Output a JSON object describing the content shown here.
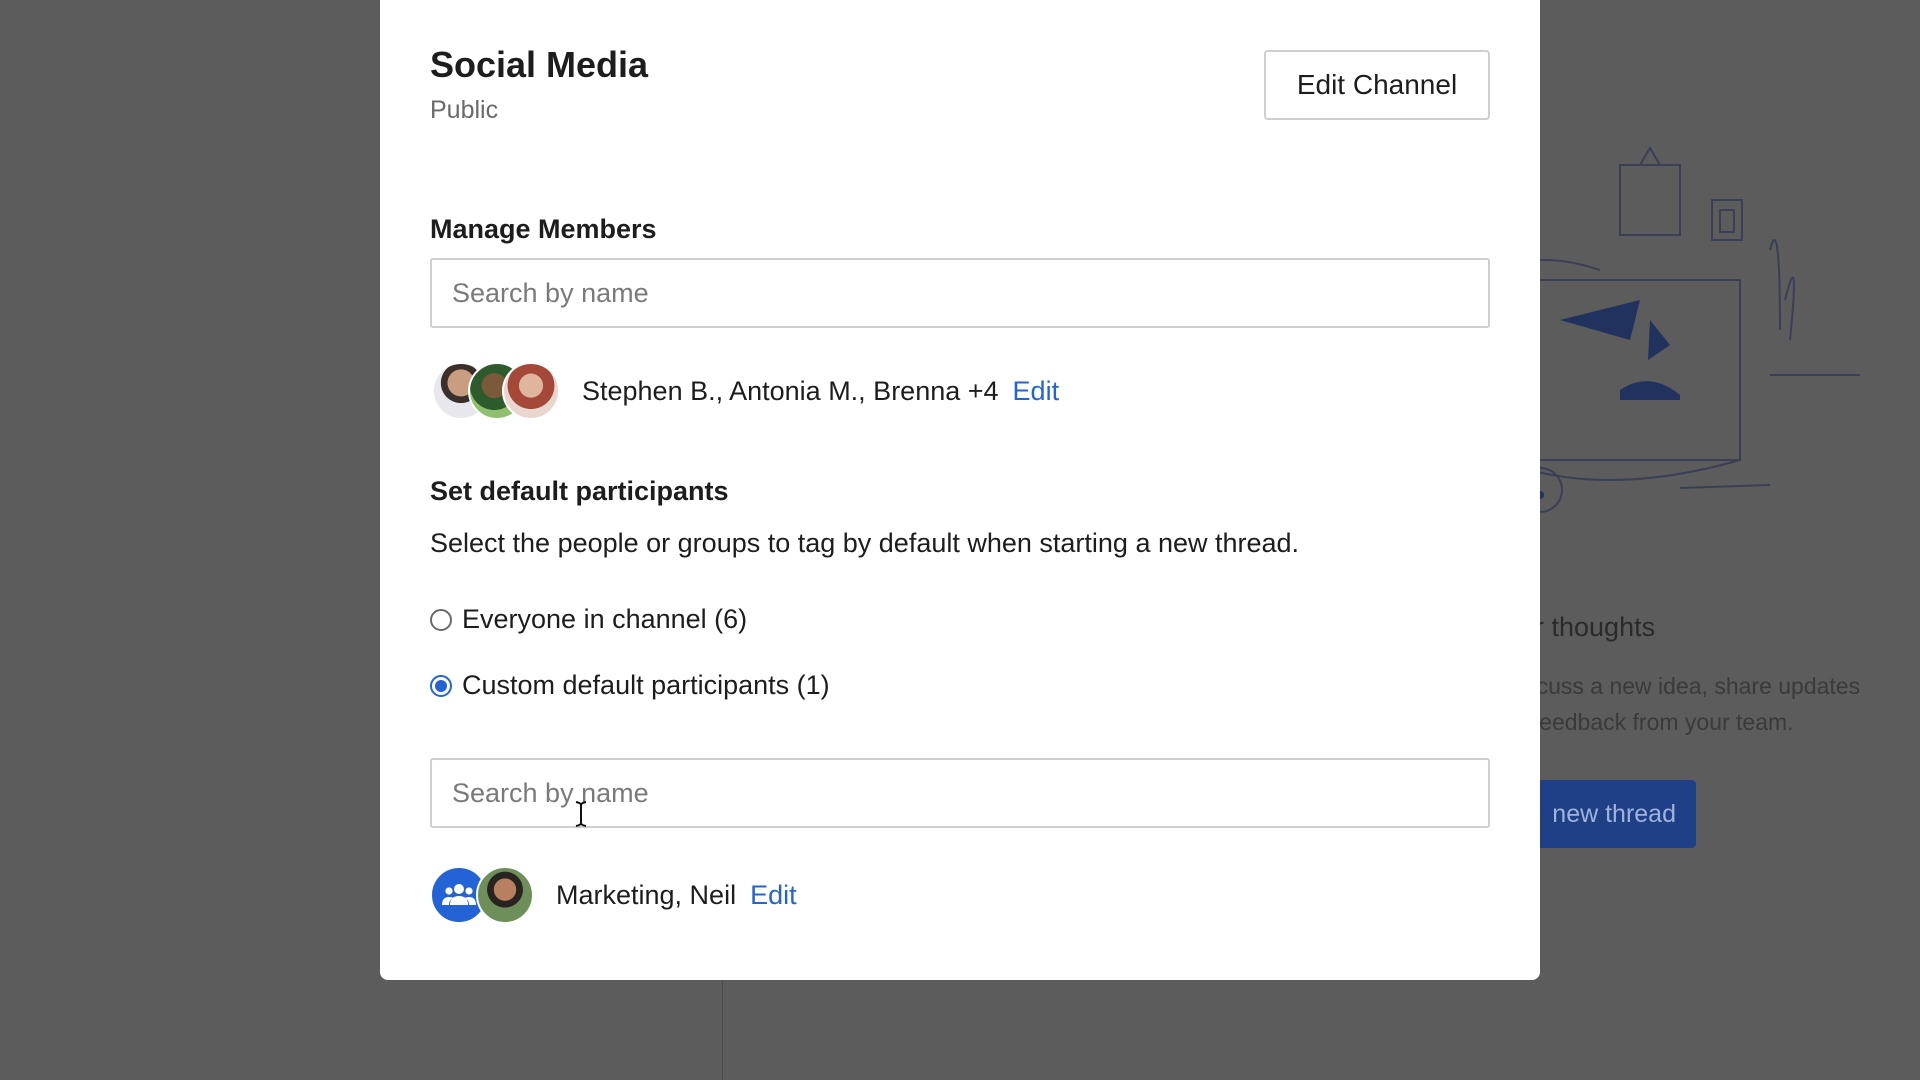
{
  "background": {
    "heading": "ur thoughts",
    "body_lines": [
      "iscuss a new idea, share updates",
      "t feedback from your team."
    ],
    "button_label": "new thread"
  },
  "modal": {
    "title": "Social Media",
    "visibility": "Public",
    "edit_channel_label": "Edit Channel",
    "manage_members": {
      "heading": "Manage Members",
      "search_placeholder": "Search by name",
      "members_summary": "Stephen B., Antonia M., Brenna +4",
      "edit_label": "Edit"
    },
    "default_participants": {
      "heading": "Set default participants",
      "description": "Select the people or groups to tag by default when starting a new thread.",
      "options": [
        {
          "label": "Everyone in channel (6)",
          "checked": false
        },
        {
          "label": "Custom default participants (1)",
          "checked": true
        }
      ],
      "search_placeholder": "Search by name",
      "participants_summary": "Marketing, Neil",
      "edit_label": "Edit"
    }
  },
  "colors": {
    "accent": "#2463d6",
    "backdrop": "#5c5c5c",
    "bg_button": "#1f3f86"
  }
}
